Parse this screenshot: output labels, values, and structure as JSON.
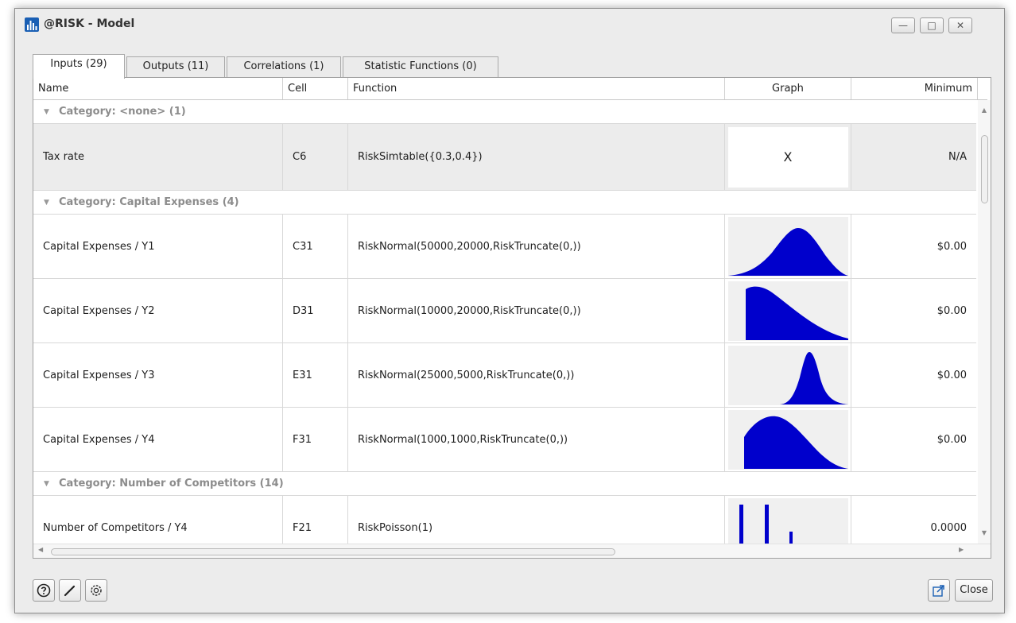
{
  "window": {
    "title": "@RISK - Model",
    "controls": {
      "minimize": "—",
      "maximize": "□",
      "close": "✕"
    }
  },
  "tabs": [
    {
      "label": "Inputs (29)",
      "active": true
    },
    {
      "label": "Outputs (11)",
      "active": false
    },
    {
      "label": "Correlations (1)",
      "active": false
    },
    {
      "label": "Statistic Functions (0)",
      "active": false
    }
  ],
  "table": {
    "columns": {
      "name": "Name",
      "cell": "Cell",
      "function": "Function",
      "graph": "Graph",
      "minimum": "Minimum"
    },
    "categories": [
      {
        "label": "Category: <none> (1)",
        "rows": [
          {
            "name": "Tax rate",
            "cell": "C6",
            "function": "RiskSimtable({0.3,0.4})",
            "graph_text": "X",
            "minimum": "N/A",
            "selected": true
          }
        ]
      },
      {
        "label": "Category: Capital Expenses (4)",
        "rows": [
          {
            "name": "Capital Expenses / Y1",
            "cell": "C31",
            "function": "RiskNormal(50000,20000,RiskTruncate(0,))",
            "minimum": "$0.00"
          },
          {
            "name": "Capital Expenses / Y2",
            "cell": "D31",
            "function": "RiskNormal(10000,20000,RiskTruncate(0,))",
            "minimum": "$0.00"
          },
          {
            "name": "Capital Expenses / Y3",
            "cell": "E31",
            "function": "RiskNormal(25000,5000,RiskTruncate(0,))",
            "minimum": "$0.00"
          },
          {
            "name": "Capital Expenses / Y4",
            "cell": "F31",
            "function": "RiskNormal(1000,1000,RiskTruncate(0,))",
            "minimum": "$0.00"
          }
        ]
      },
      {
        "label": "Category: Number of Competitors (14)",
        "rows": [
          {
            "name": "Number of Competitors / Y4",
            "cell": "F21",
            "function": "RiskPoisson(1)",
            "minimum": "0.0000"
          }
        ]
      }
    ]
  },
  "footer": {
    "close_label": "Close"
  },
  "colors": {
    "graph_fill": "#0000cc",
    "category_text": "#8c8c8c"
  },
  "icons": [
    "app-chart-icon",
    "help-icon",
    "edit-pencil-icon",
    "settings-icon",
    "export-icon"
  ]
}
